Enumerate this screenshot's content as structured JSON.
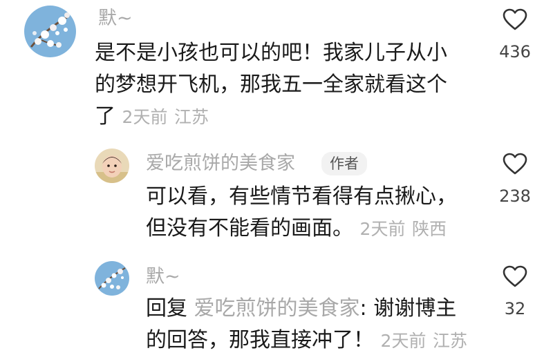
{
  "comments": [
    {
      "username": "默~",
      "text_lines": [
        "是不是小孩也可以的吧！我家儿子从小",
        "的梦想开飞机，那我五一全家就看这个",
        "了"
      ],
      "time": "2天前",
      "location": "江苏",
      "likes": "436",
      "avatar_icon": "blossom-avatar"
    },
    {
      "username": "爱吃煎饼的美食家",
      "badge": "作者",
      "text_lines": [
        "可以看，有些情节看得有点揪心，",
        "但没有不能看的画面。"
      ],
      "time": "2天前",
      "location": "陕西",
      "likes": "238",
      "avatar_icon": "child-avatar"
    },
    {
      "username": "默~",
      "reply_prefix": "回复",
      "reply_target": "爱吃煎饼的美食家",
      "reply_text_first": ": 谢谢博主",
      "reply_text_second": "的回答，那我直接冲了！",
      "time": "2天前",
      "location": "江苏",
      "likes": "32",
      "avatar_icon": "blossom-avatar"
    }
  ],
  "colors": {
    "username": "#a8a8a8",
    "meta": "#b0b0b0",
    "text": "#1a1a1a",
    "heart_outline": "#333333"
  }
}
